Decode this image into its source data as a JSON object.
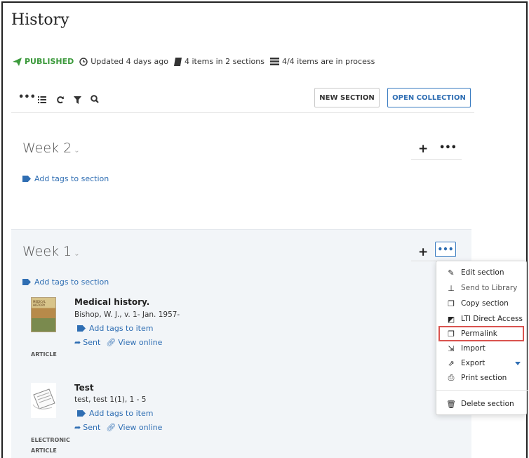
{
  "page": {
    "title": "History"
  },
  "meta": {
    "status": "PUBLISHED",
    "updated": "Updated 4 days ago",
    "items_count": "4 items in 2 sections",
    "process": "4/4 items are in process"
  },
  "toolbar": {
    "icons": [
      "more-icon",
      "list-icon",
      "refresh-icon",
      "filter-icon",
      "search-icon"
    ],
    "new_section": "NEW SECTION",
    "open_collection": "OPEN COLLECTION"
  },
  "sections": [
    {
      "title": "Week 2",
      "tags_link": "Add tags to section"
    },
    {
      "title": "Week 1",
      "tags_link": "Add tags to section",
      "items": [
        {
          "title": "Medical history.",
          "author": "Bishop, W. J., v. 1- Jan. 1957-",
          "tags_link": "Add tags to item",
          "sent": "Sent",
          "view_online": "View online",
          "type": "ARTICLE",
          "thumb_text": "MEDICAL HISTORY"
        },
        {
          "title": "Test",
          "author": "test, test 1(1), 1 - 5",
          "tags_link": "Add tags to item",
          "sent": "Sent",
          "view_online": "View online",
          "type_line1": "ELECTRONIC",
          "type_line2": "ARTICLE"
        }
      ]
    }
  ],
  "menu": {
    "items": [
      {
        "label": "Edit section",
        "icon": "pencil-icon"
      },
      {
        "label": "Send to Library",
        "icon": "pin-icon"
      },
      {
        "label": "Copy section",
        "icon": "copy-icon"
      },
      {
        "label": "LTI Direct Access",
        "icon": "external-box-icon"
      },
      {
        "label": "Permalink",
        "icon": "copy-icon",
        "highlighted": true
      },
      {
        "label": "Import",
        "icon": "import-icon"
      },
      {
        "label": "Export",
        "icon": "export-icon"
      },
      {
        "label": "Print section",
        "icon": "print-icon"
      },
      {
        "label": "Delete section",
        "icon": "trash-icon"
      }
    ]
  },
  "colors": {
    "published": "#3c9a3c",
    "link": "#2f6eb3",
    "highlight": "#d9534f",
    "section_bg": "#f2f5f8"
  }
}
